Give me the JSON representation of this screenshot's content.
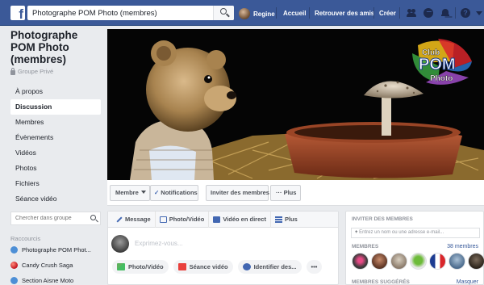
{
  "topbar": {
    "search_value": "Photographe POM Photo (membres)",
    "user_name": "Regine",
    "home": "Accueil",
    "find_friends": "Retrouver des amis",
    "create": "Créer",
    "icons": [
      "facebook-logo",
      "search-icon",
      "friend-requests-icon",
      "messenger-icon",
      "notifications-icon",
      "help-icon",
      "account-menu-icon"
    ],
    "colors": {
      "bar": "#3b5998",
      "link": "#365899"
    }
  },
  "sidebar": {
    "group_title": "Photographe POM Photo (membres)",
    "privacy": "Groupe Privé",
    "items": [
      {
        "label": "À propos"
      },
      {
        "label": "Discussion",
        "active": true
      },
      {
        "label": "Membres"
      },
      {
        "label": "Évènements"
      },
      {
        "label": "Vidéos"
      },
      {
        "label": "Photos"
      },
      {
        "label": "Fichiers"
      },
      {
        "label": "Séance vidéo"
      }
    ],
    "search_placeholder": "Chercher dans groupe",
    "shortcuts_title": "Raccourcis",
    "shortcuts": [
      {
        "label": "Photographe POM Phot..."
      },
      {
        "label": "Candy Crush Saga"
      },
      {
        "label": "Section Aisne Moto"
      }
    ]
  },
  "cover": {
    "logo_line1": "Club",
    "logo_line2": "POM",
    "logo_line3": "Photo"
  },
  "actions": {
    "member": "Membre",
    "notifications": "Notifications",
    "invite": "Inviter des membres",
    "more": "Plus"
  },
  "composer": {
    "tabs": [
      "Message",
      "Photo/Vidéo",
      "Vidéo en direct",
      "Plus"
    ],
    "placeholder": "Exprimez-vous...",
    "bottom": [
      "Photo/Vidéo",
      "Séance vidéo",
      "Identifier des...",
      "•••"
    ]
  },
  "invite_box": {
    "title": "INVITER DES MEMBRES",
    "input_placeholder": "Entrez un nom ou une adresse e-mail...",
    "members_label": "MEMBRES",
    "members_count": "38 membres",
    "suggested_label": "MEMBRES SUGGÉRÉS",
    "hide": "Masquer"
  }
}
